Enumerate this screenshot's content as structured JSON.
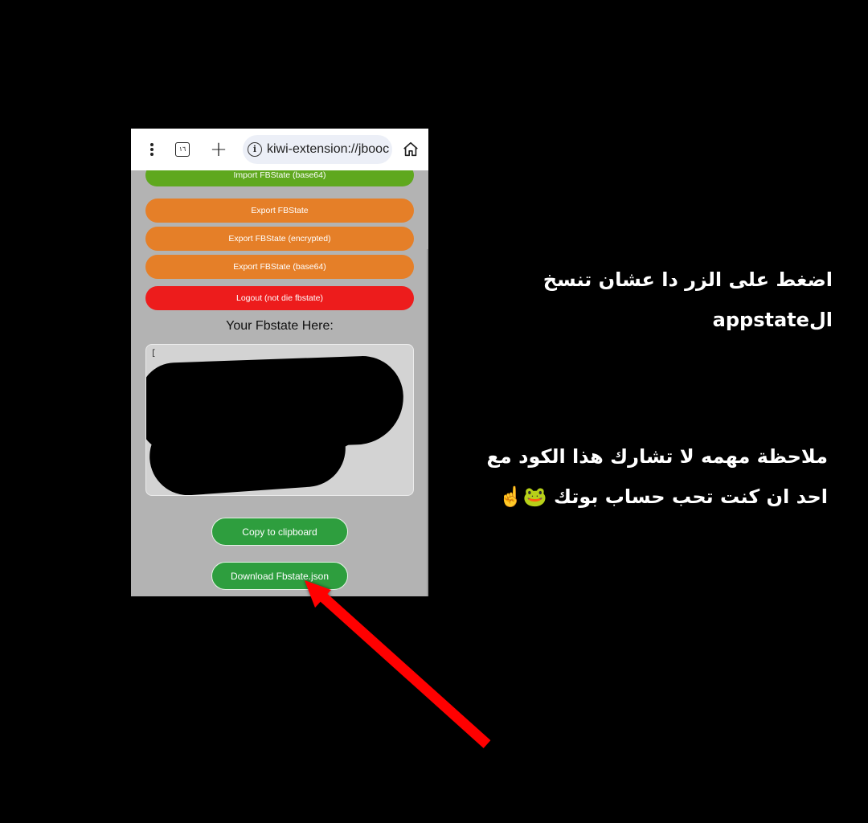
{
  "browser": {
    "tab_count": "١٦",
    "url": "kiwi-extension://jbooc"
  },
  "buttons": {
    "import_base64": "Import FBState (base64)",
    "export": "Export FBState",
    "export_encrypted": "Export FBState (encrypted)",
    "export_base64": "Export FBState (base64)",
    "logout": "Logout (not die fbstate)"
  },
  "fbstate": {
    "heading": "Your Fbstate Here:",
    "textarea_prefix": "["
  },
  "actions": {
    "copy": "Copy to clipboard",
    "download": "Download Fbstate.json"
  },
  "captions": {
    "instruction_line1": "اضغط على الزر دا عشان تنسخ",
    "instruction_line2": "الappstate",
    "warning_line1": "ملاحظة مهمه لا تشارك هذا الكود مع",
    "warning_line2": "احد ان كنت تحب حساب بوتك",
    "warning_emojis": "🐸☝️"
  },
  "colors": {
    "import_green": "#5fa81e",
    "export_orange": "#e57f28",
    "logout_red": "#ed1c1c",
    "action_green": "#2e9e3e",
    "arrow_red": "#ff0000"
  }
}
